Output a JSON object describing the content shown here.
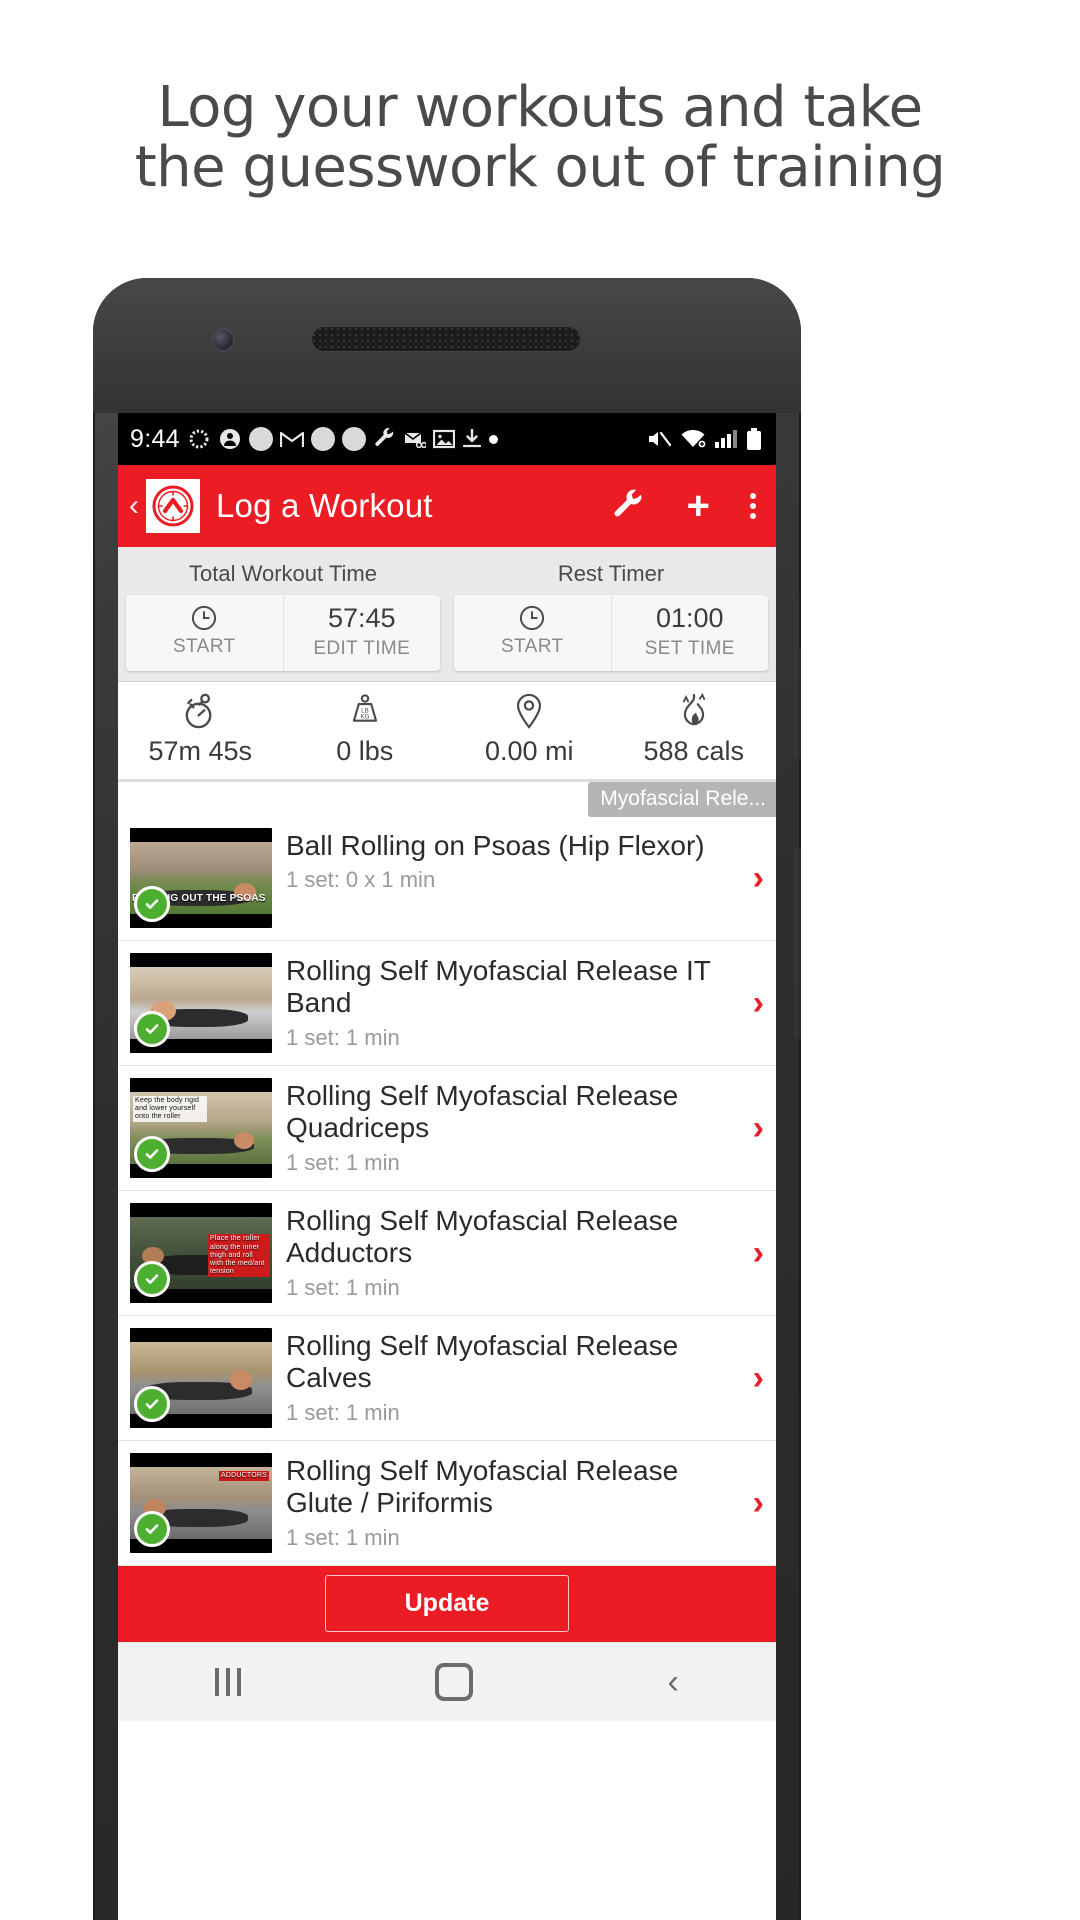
{
  "headline": {
    "line1": "Log your workouts and take",
    "line2": "the guesswork out of training"
  },
  "status_bar": {
    "time": "9:44",
    "left_icons": [
      "sync-icon",
      "account-icon",
      "circle-notification-icon",
      "gmail-icon",
      "circle-notification-icon",
      "circle-notification-icon",
      "wrench-icon",
      "mail-open-icon",
      "image-icon",
      "download-icon",
      "dot-icon"
    ],
    "right_icons": [
      "mute-icon",
      "wifi-icon",
      "signal-icon",
      "battery-icon"
    ]
  },
  "app_bar": {
    "back_label": "‹",
    "title": "Log a Workout",
    "actions": [
      "wrench-icon",
      "plus-icon",
      "overflow-menu-icon"
    ],
    "accent_color": "#ec1c24"
  },
  "timers": [
    {
      "label": "Total Workout Time",
      "start_button": "START",
      "value": "57:45",
      "value_caption": "EDIT TIME"
    },
    {
      "label": "Rest Timer",
      "start_button": "START",
      "value": "01:00",
      "value_caption": "SET TIME"
    }
  ],
  "stats": [
    {
      "icon": "stopwatch-icon",
      "value": "57m 45s"
    },
    {
      "icon": "weight-icon",
      "value": "0 lbs"
    },
    {
      "icon": "location-pin-icon",
      "value": "0.00 mi"
    },
    {
      "icon": "calories-flame-icon",
      "value": "588 cals"
    }
  ],
  "section_tab": "Myofascial Rele...",
  "exercises": [
    {
      "title": "Ball Rolling on Psoas (Hip Flexor)",
      "detail": "1 set: 0 x 1 min",
      "thumb_caption": "ROLLING OUT THE PSOAS",
      "completed": true
    },
    {
      "title": "Rolling Self Myofascial Release IT Band",
      "detail": "1 set: 1 min",
      "thumb_caption": "",
      "completed": true
    },
    {
      "title": "Rolling Self Myofascial Release Quadriceps",
      "detail": "1 set: 1 min",
      "thumb_caption": "Keep the body rigid and lower yourself onto the roller",
      "completed": true
    },
    {
      "title": "Rolling Self Myofascial Release Adductors",
      "detail": "1 set: 1 min",
      "thumb_caption": "Place the roller along the inner thigh and roll with the med/ant tension",
      "completed": true
    },
    {
      "title": "Rolling Self Myofascial Release Calves",
      "detail": "1 set: 1 min",
      "thumb_caption": "",
      "completed": true
    },
    {
      "title": "Rolling Self Myofascial Release Glute / Piriformis",
      "detail": "1 set: 1 min",
      "thumb_caption": "ADDUCTORS",
      "completed": true
    }
  ],
  "bottom_bar": {
    "update_label": "Update"
  },
  "nav_bar": {
    "recent": "recent-apps-icon",
    "home": "home-icon",
    "back": "back-icon"
  }
}
